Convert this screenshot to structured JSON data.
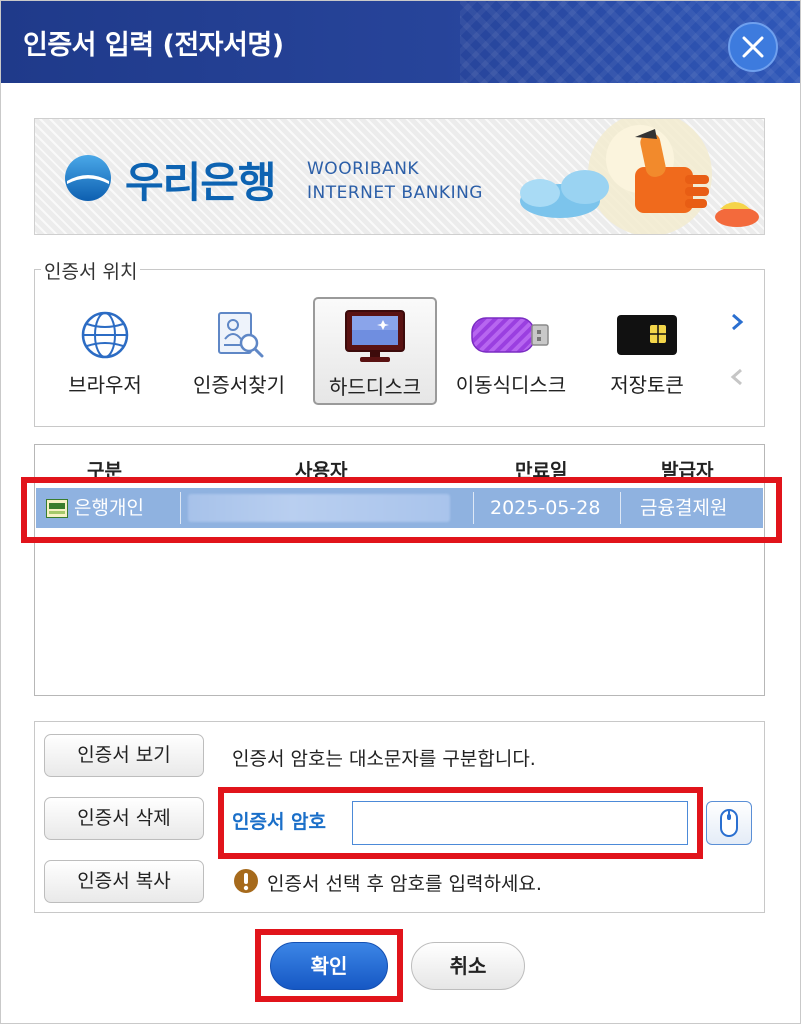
{
  "dialog": {
    "title": "인증서 입력 (전자서명)",
    "close_icon": "close-icon"
  },
  "banner": {
    "brand_name": "우리은행",
    "brand_en_line1": "WOORIBANK",
    "brand_en_line2": "INTERNET BANKING"
  },
  "location": {
    "legend": "인증서 위치",
    "items": [
      {
        "label": "브라우저",
        "icon": "globe-icon"
      },
      {
        "label": "인증서찾기",
        "icon": "certificate-search-icon"
      },
      {
        "label": "하드디스크",
        "icon": "monitor-icon",
        "selected": true
      },
      {
        "label": "이동식디스크",
        "icon": "usb-drive-icon"
      },
      {
        "label": "저장토큰",
        "icon": "security-token-icon"
      }
    ]
  },
  "table": {
    "headers": [
      "구분",
      "사용자",
      "만료일",
      "발급자"
    ],
    "rows": [
      {
        "type": "은행개인",
        "user": "",
        "expiry": "2025-05-28",
        "issuer": "금융결제원",
        "selected": true
      }
    ]
  },
  "actions": {
    "view_label": "인증서 보기",
    "delete_label": "인증서 삭제",
    "copy_label": "인증서 복사",
    "case_notice": "인증서 암호는 대소문자를 구분합니다.",
    "password_label": "인증서 암호",
    "password_value": "",
    "hint": "인증서 선택 후 암호를 입력하세요."
  },
  "buttons": {
    "ok_label": "확인",
    "cancel_label": "취소"
  },
  "colors": {
    "title_bar": "#27449a",
    "selected_row": "#8fb2e0",
    "highlight": "#e1141b",
    "accent": "#1a6fc9"
  }
}
